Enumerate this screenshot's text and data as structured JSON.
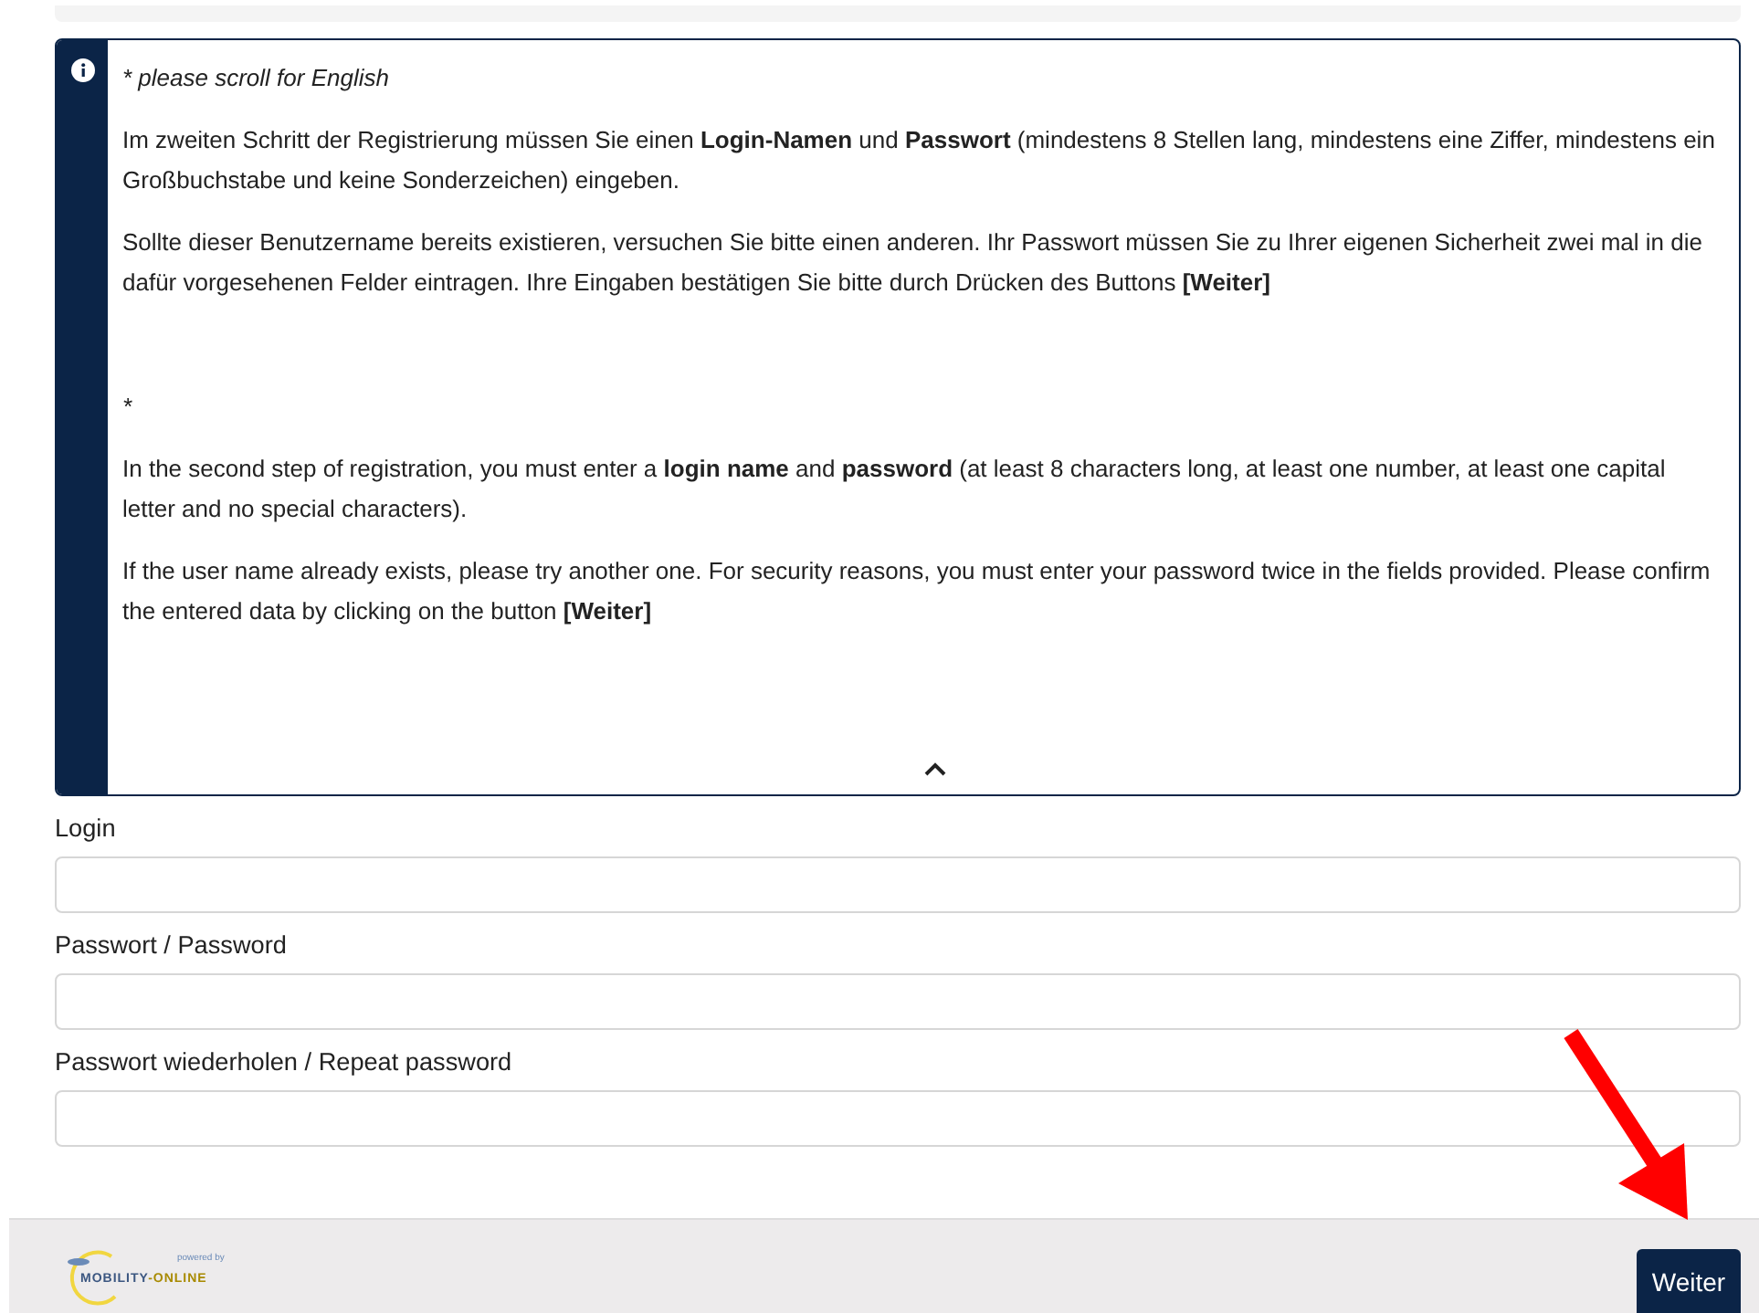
{
  "info_box": {
    "paragraphs": [
      {
        "kind": "italic",
        "text": "* please scroll for English"
      },
      {
        "kind": "plain",
        "text": "Im zweiten Schritt der Registrierung müssen Sie einen **Login-Namen** und **Passwort** (mindestens 8 Stellen lang, mindestens eine Ziffer, mindestens ein Großbuchstabe und keine Sonderzeichen) eingeben."
      },
      {
        "kind": "plain",
        "text": "Sollte dieser Benutzername bereits existieren, versuchen Sie bitte einen anderen. Ihr Passwort müssen Sie zu Ihrer eigenen Sicherheit zwei mal in die dafür vorgesehenen Felder eintragen. Ihre Eingaben bestätigen Sie bitte durch Drücken des Buttons **[Weiter]**"
      },
      {
        "kind": "spacer-italic",
        "text": "*"
      },
      {
        "kind": "plain",
        "text": "In the second step of registration, you must enter a **login name** and **password** (at least 8 characters long, at least one number, at least one capital letter and no special characters)."
      },
      {
        "kind": "plain",
        "text": "If the user name already exists, please try another one. For security reasons, you must enter your password twice in the fields provided. Please confirm the entered data by clicking on the button **[Weiter]**"
      }
    ]
  },
  "fields": [
    {
      "label": "Login"
    },
    {
      "label": "Passwort / Password"
    },
    {
      "label": "Passwort wiederholen / Repeat password"
    }
  ],
  "footer": {
    "logo": {
      "powered_by": "powered by",
      "name_left": "MOBILITY",
      "name_right": "-ONLINE"
    },
    "button": "Weiter"
  }
}
